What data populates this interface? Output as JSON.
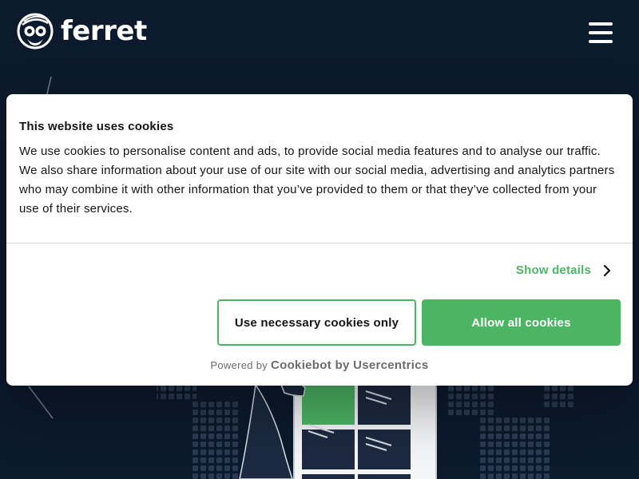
{
  "header": {
    "logo_text": "ferret",
    "logo_icon": "ferret-face-icon",
    "menu_icon": "hamburger-menu-icon"
  },
  "cookie_dialog": {
    "title": "This website uses cookies",
    "body": "We use cookies to personalise content and ads, to provide social media features and to analyse our traffic. We also share information about your use of our site with our social media, advertising and analytics partners who may combine it with other information that you’ve provided to them or that they’ve collected from your use of their services.",
    "show_details_label": "Show details",
    "show_details_icon": "chevron-right-icon",
    "necessary_button_label": "Use necessary cookies only",
    "allow_all_button_label": "Allow all cookies",
    "powered_by_prefix": "Powered by",
    "powered_by_brand": "Cookiebot by Usercentrics"
  },
  "colors": {
    "page_background": "#0c1a2d",
    "accent_green": "#4cb563",
    "dialog_background": "#ffffff",
    "text_dark": "#141414"
  }
}
